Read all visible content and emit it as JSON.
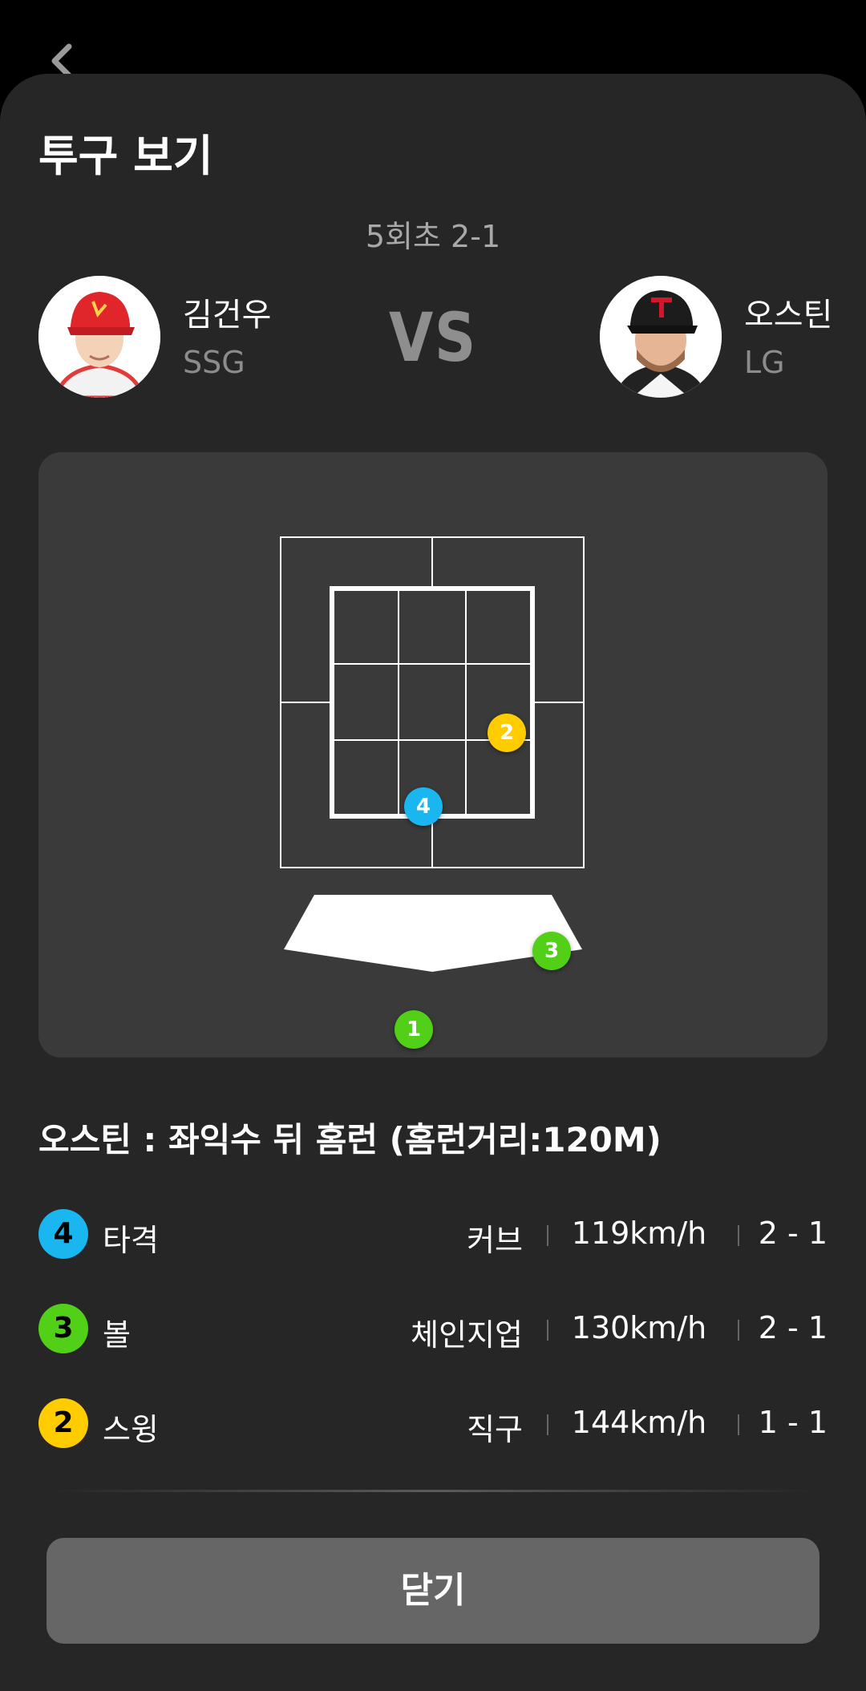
{
  "header": {
    "title": "투구 보기",
    "inning_score": "5회초 2-1"
  },
  "matchup": {
    "pitcher": {
      "name": "김건우",
      "team": "SSG"
    },
    "vs_label": "VS",
    "batter": {
      "name": "오스틴",
      "team": "LG"
    }
  },
  "markers": [
    {
      "number": "2",
      "color": "#ffcc00"
    },
    {
      "number": "4",
      "color": "#1ab6f0"
    },
    {
      "number": "3",
      "color": "#52d017"
    },
    {
      "number": "1",
      "color": "#52d017"
    }
  ],
  "result_text": "오스틴 : 좌익수 뒤 홈런 (홈런거리:120M)",
  "pitches": [
    {
      "number": "4",
      "color": "#1ab6f0",
      "label": "타격",
      "pitch_type": "커브",
      "speed": "119km/h",
      "count": "2 - 1"
    },
    {
      "number": "3",
      "color": "#52d017",
      "label": "볼",
      "pitch_type": "체인지업",
      "speed": "130km/h",
      "count": "2 - 1"
    },
    {
      "number": "2",
      "color": "#ffcc00",
      "label": "스윙",
      "pitch_type": "직구",
      "speed": "144km/h",
      "count": "1 - 1"
    }
  ],
  "close_button": "닫기"
}
